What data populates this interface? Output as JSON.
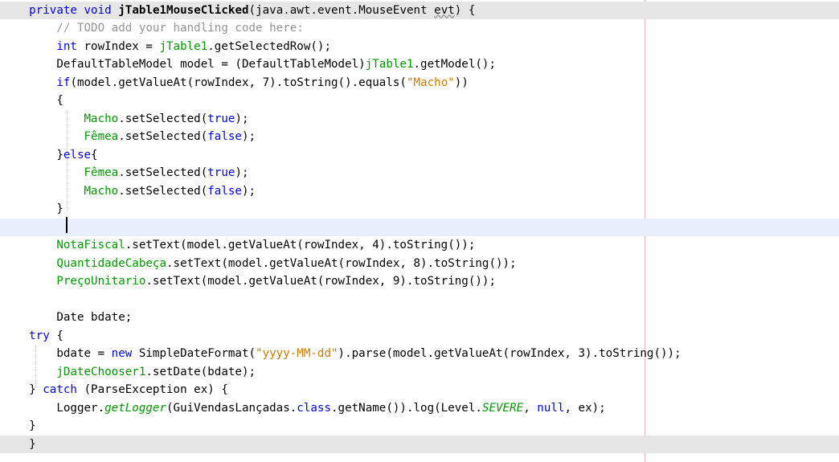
{
  "code_lines": [
    [
      {
        "t": "    "
      },
      {
        "t": "private",
        "c": "kw"
      },
      {
        "t": " "
      },
      {
        "t": "void",
        "c": "kw"
      },
      {
        "t": " "
      },
      {
        "t": "jTable1MouseClicked",
        "c": "bold"
      },
      {
        "t": "(java.awt.event.MouseEvent "
      },
      {
        "t": "evt",
        "c": "squig"
      },
      {
        "t": ") {"
      }
    ],
    [
      {
        "t": "        "
      },
      {
        "t": "// TODO add your handling code here:",
        "c": "cmt"
      }
    ],
    [
      {
        "t": "        "
      },
      {
        "t": "int",
        "c": "kw"
      },
      {
        "t": " rowIndex = "
      },
      {
        "t": "jTable1",
        "c": "fld"
      },
      {
        "t": ".getSelectedRow();"
      }
    ],
    [
      {
        "t": "        DefaultTableModel model = (DefaultTableModel)"
      },
      {
        "t": "jTable1",
        "c": "fld"
      },
      {
        "t": ".getModel();"
      }
    ],
    [
      {
        "t": "        "
      },
      {
        "t": "if",
        "c": "kw"
      },
      {
        "t": "(model.getValueAt(rowIndex, 7).toString().equals("
      },
      {
        "t": "\"Macho\"",
        "c": "str"
      },
      {
        "t": "))"
      }
    ],
    [
      {
        "t": "        {"
      }
    ],
    [
      {
        "t": "            "
      },
      {
        "t": "Macho",
        "c": "fld"
      },
      {
        "t": ".setSelected("
      },
      {
        "t": "true",
        "c": "kw"
      },
      {
        "t": ");"
      }
    ],
    [
      {
        "t": "            "
      },
      {
        "t": "Fêmea",
        "c": "fld"
      },
      {
        "t": ".setSelected("
      },
      {
        "t": "false",
        "c": "kw"
      },
      {
        "t": ");"
      }
    ],
    [
      {
        "t": "        }"
      },
      {
        "t": "else",
        "c": "kw"
      },
      {
        "t": "{"
      }
    ],
    [
      {
        "t": "            "
      },
      {
        "t": "Fêmea",
        "c": "fld"
      },
      {
        "t": ".setSelected("
      },
      {
        "t": "true",
        "c": "kw"
      },
      {
        "t": ");"
      }
    ],
    [
      {
        "t": "            "
      },
      {
        "t": "Macho",
        "c": "fld"
      },
      {
        "t": ".setSelected("
      },
      {
        "t": "false",
        "c": "kw"
      },
      {
        "t": ");"
      }
    ],
    [
      {
        "t": "        }"
      }
    ],
    [
      {
        "t": ""
      }
    ],
    [
      {
        "t": "        "
      },
      {
        "t": "NotaFiscal",
        "c": "fld"
      },
      {
        "t": ".setText(model.getValueAt(rowIndex, 4).toString());"
      }
    ],
    [
      {
        "t": "        "
      },
      {
        "t": "QuantidadeCabeça",
        "c": "fld"
      },
      {
        "t": ".setText(model.getValueAt(rowIndex, 8).toString());"
      }
    ],
    [
      {
        "t": "        "
      },
      {
        "t": "PreçoUnitario",
        "c": "fld"
      },
      {
        "t": ".setText(model.getValueAt(rowIndex, 9).toString());"
      }
    ],
    [
      {
        "t": ""
      }
    ],
    [
      {
        "t": "        Date bdate;"
      }
    ],
    [
      {
        "t": "    "
      },
      {
        "t": "try",
        "c": "kw"
      },
      {
        "t": " {"
      }
    ],
    [
      {
        "t": "        bdate = "
      },
      {
        "t": "new",
        "c": "kw"
      },
      {
        "t": " SimpleDateFormat("
      },
      {
        "t": "\"yyyy-MM-dd\"",
        "c": "str"
      },
      {
        "t": ").parse(model.getValueAt(rowIndex, 3).toString());"
      }
    ],
    [
      {
        "t": "        "
      },
      {
        "t": "jDateChooser1",
        "c": "fld"
      },
      {
        "t": ".setDate(bdate);"
      }
    ],
    [
      {
        "t": "    } "
      },
      {
        "t": "catch",
        "c": "kw"
      },
      {
        "t": " (ParseException ex) {"
      }
    ],
    [
      {
        "t": "        Logger."
      },
      {
        "t": "getLogger",
        "c": "stat"
      },
      {
        "t": "(GuiVendasLançadas."
      },
      {
        "t": "class",
        "c": "kw"
      },
      {
        "t": ".getName()).log(Level."
      },
      {
        "t": "SEVERE",
        "c": "stat"
      },
      {
        "t": ", "
      },
      {
        "t": "null",
        "c": "kw"
      },
      {
        "t": ", ex);"
      }
    ],
    [
      {
        "t": "    }"
      }
    ],
    [
      {
        "t": "    }"
      }
    ]
  ],
  "editor_colors": {
    "keyword": "#0000e6",
    "field": "#009900",
    "string": "#ce7b00",
    "comment": "#969696",
    "margin_line": "#f2b6b6",
    "highlight_line": "#e6e6e6",
    "caret_line": "#e9effa"
  }
}
